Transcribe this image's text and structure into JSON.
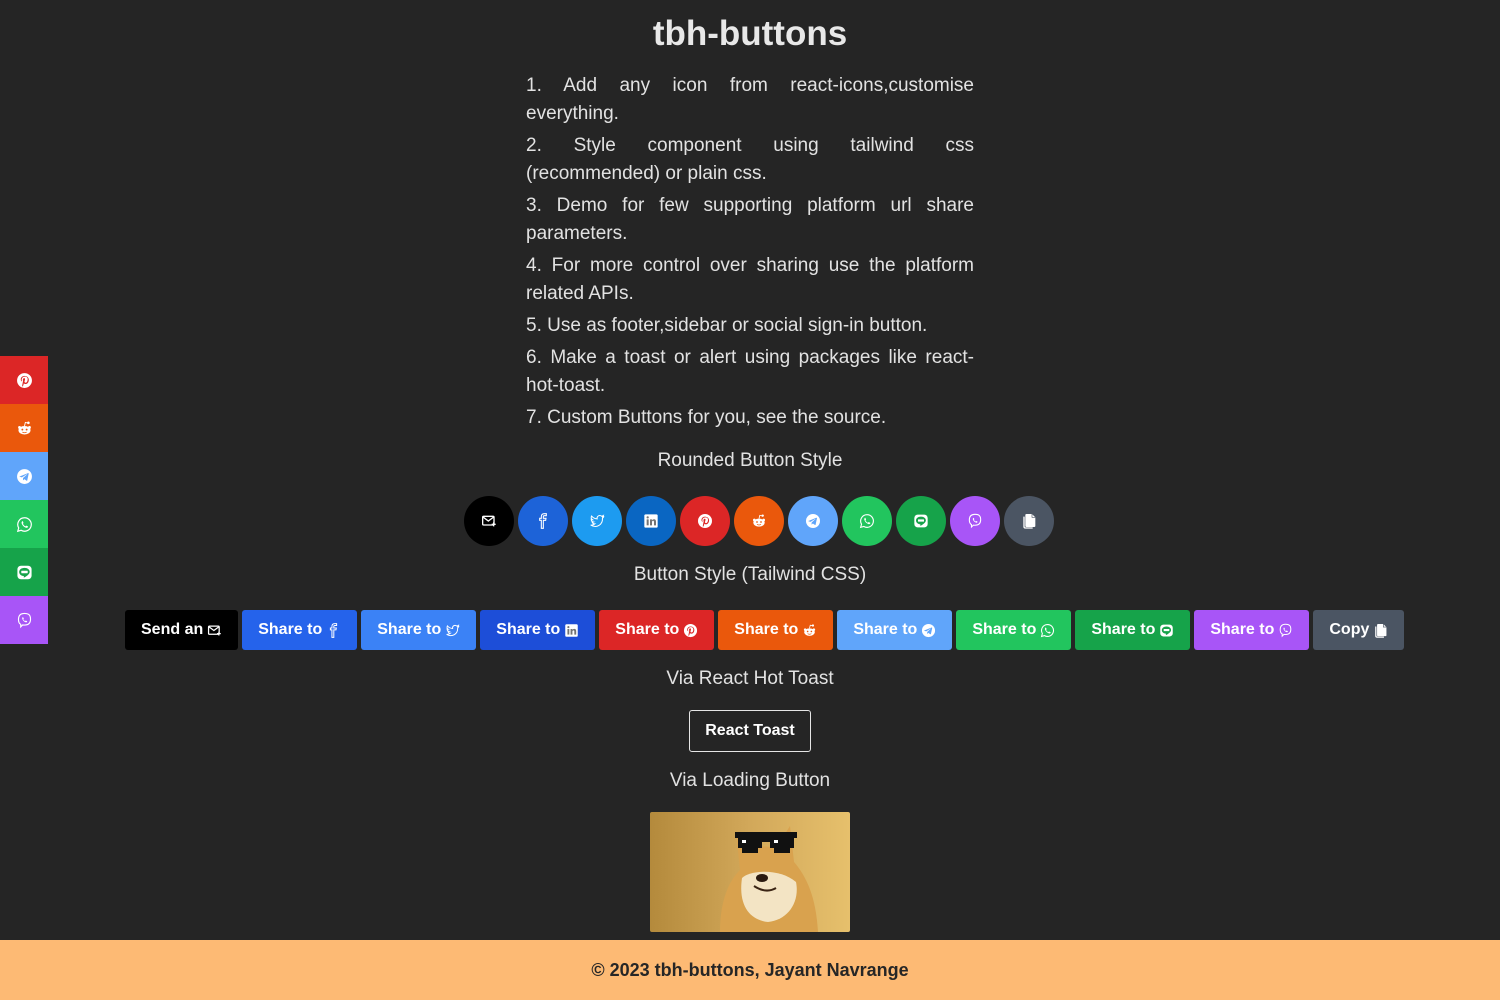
{
  "page": {
    "title": "tbh-buttons"
  },
  "features": [
    "1. Add any icon from react-icons,customise everything.",
    "2. Style component using tailwind css (recommended) or plain css.",
    "3. Demo for few supporting platform url share parameters.",
    "4. For more control over sharing use the platform related APIs.",
    "5. Use as footer,sidebar or social sign-in button.",
    "6. Make a toast or alert using packages like react-hot-toast.",
    "7. Custom Buttons for you, see the source."
  ],
  "sections": {
    "rounded": "Rounded Button Style",
    "tailwind": "Button Style (Tailwind CSS)",
    "toast": "Via React Hot Toast",
    "loading": "Via Loading Button"
  },
  "colors": {
    "email": "#000000",
    "facebook": "#1d63d8",
    "twitter": "#1d9bf0",
    "linkedin": "#0a66c2",
    "pinterest": "#dc2626",
    "reddit": "#ea580c",
    "telegram": "#60a5fa",
    "whatsapp": "#22c55e",
    "line": "#16a34a",
    "viber": "#a855f7",
    "copy": "#4b5563",
    "tw_facebook": "#2563eb",
    "tw_twitter": "#3b82f6",
    "tw_linkedin": "#1d4ed8",
    "footer_bg": "#fdba74",
    "page_bg": "#252525"
  },
  "tailwind_buttons": [
    {
      "label": "Send an",
      "icon": "email-icon"
    },
    {
      "label": "Share to",
      "icon": "facebook-icon"
    },
    {
      "label": "Share to",
      "icon": "twitter-icon"
    },
    {
      "label": "Share to",
      "icon": "linkedin-icon"
    },
    {
      "label": "Share to",
      "icon": "pinterest-icon"
    },
    {
      "label": "Share to",
      "icon": "reddit-icon"
    },
    {
      "label": "Share to",
      "icon": "telegram-icon"
    },
    {
      "label": "Share to",
      "icon": "whatsapp-icon"
    },
    {
      "label": "Share to",
      "icon": "line-icon"
    },
    {
      "label": "Share to",
      "icon": "viber-icon"
    },
    {
      "label": "Copy",
      "icon": "copy-icon"
    }
  ],
  "toast_button": {
    "label": "React Toast"
  },
  "loading_image": {
    "alt": "doge with sunglasses"
  },
  "footer": {
    "text": "© 2023 tbh-buttons, Jayant Navrange"
  }
}
